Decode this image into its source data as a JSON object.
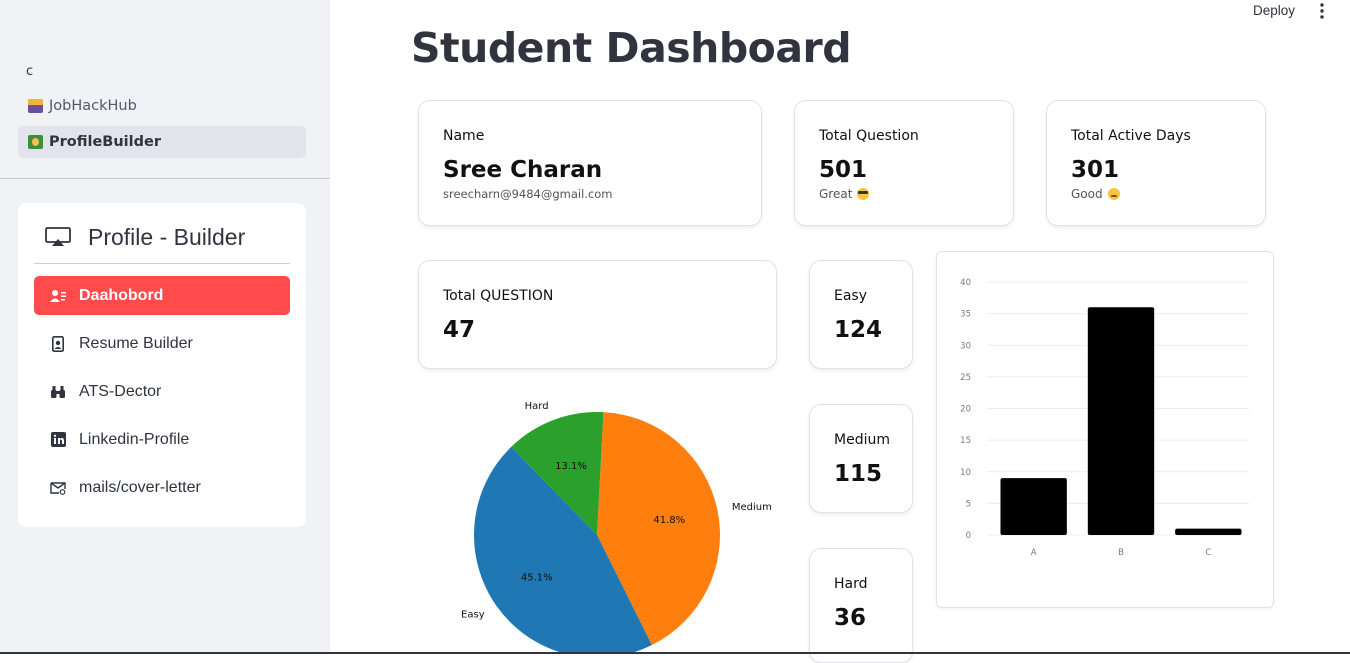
{
  "sidebar": {
    "top_label": "c",
    "nav": [
      {
        "label": "JobHackHub",
        "icon": "card-file-box-icon"
      },
      {
        "label": "ProfileBuilder",
        "icon": "construction-worker-icon"
      }
    ],
    "menu_title": "Profile - Builder",
    "menu_items": [
      {
        "label": "Daahobord",
        "icon": "person-lines-icon"
      },
      {
        "label": "Resume Builder",
        "icon": "person-badge-icon"
      },
      {
        "label": "ATS-Dector",
        "icon": "binoculars-icon"
      },
      {
        "label": "Linkedin-Profile",
        "icon": "linkedin-icon"
      },
      {
        "label": "mails/cover-letter",
        "icon": "envelope-at-icon"
      }
    ]
  },
  "header": {
    "deploy_label": "Deploy"
  },
  "page": {
    "title": "Student Dashboard"
  },
  "cards": {
    "name": {
      "label": "Name",
      "value": "Sree Charan",
      "sub": "sreecharn@9484@gmail.com"
    },
    "total_question": {
      "label": "Total Question",
      "value": "501",
      "sub": "Great"
    },
    "active_days": {
      "label": "Total Active Days",
      "value": "301",
      "sub": "Good"
    },
    "total_question_2": {
      "label": "Total QUESTION",
      "value": "47"
    },
    "easy": {
      "label": "Easy",
      "value": "124"
    },
    "medium": {
      "label": "Medium",
      "value": "115"
    },
    "hard": {
      "label": "Hard",
      "value": "36"
    }
  },
  "colors": {
    "accent": "#ff4b4b",
    "easy": "#1f77b4",
    "medium": "#ff7f0e",
    "hard": "#2ca02c"
  },
  "chart_data": [
    {
      "type": "pie",
      "slices": [
        {
          "label": "Easy",
          "value": 45.1,
          "pct_label": "45.1%",
          "color": "#1f77b4"
        },
        {
          "label": "Medium",
          "value": 41.8,
          "pct_label": "41.8%",
          "color": "#ff7f0e"
        },
        {
          "label": "Hard",
          "value": 13.1,
          "pct_label": "13.1%",
          "color": "#2ca02c"
        }
      ]
    },
    {
      "type": "bar",
      "categories": [
        "A",
        "B",
        "C"
      ],
      "values": [
        9,
        36,
        1
      ],
      "ylim": [
        0,
        40
      ],
      "yticks": [
        0,
        5,
        10,
        15,
        20,
        25,
        30,
        35,
        40
      ],
      "grid": true,
      "bar_color": "#000000"
    }
  ]
}
